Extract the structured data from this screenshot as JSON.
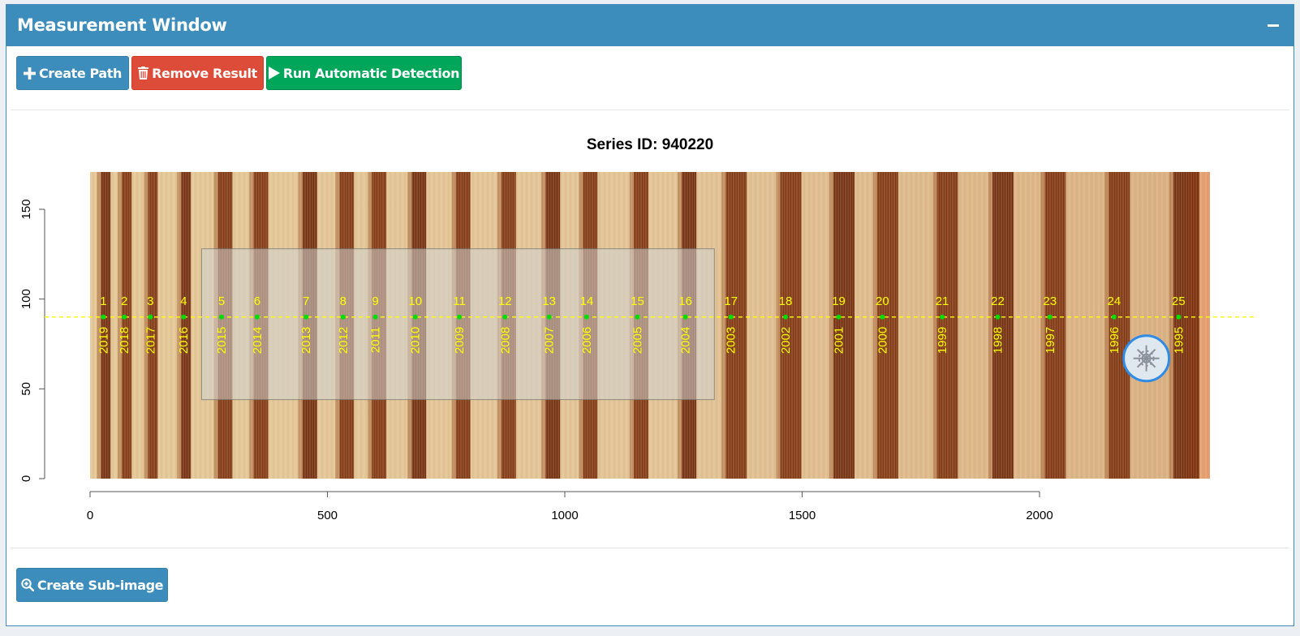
{
  "window": {
    "title": "Measurement Window",
    "collapse_icon": "minus-icon"
  },
  "toolbar": {
    "create_path_label": "Create Path",
    "remove_result_label": "Remove Result",
    "run_detection_label": "Run Automatic Detection"
  },
  "footer": {
    "create_subimage_label": "Create Sub-image"
  },
  "colors": {
    "header": "#3c8dbc",
    "btn_blue": "#3c8dbc",
    "btn_red": "#dd4b39",
    "btn_green": "#00a65a",
    "path_line": "#ffff00",
    "point": "#00dd00",
    "selection": "#cccccc"
  },
  "plot": {
    "title": "Series ID: 940220",
    "x_ticks": [
      0,
      500,
      1000,
      1500,
      2000
    ],
    "y_ticks": [
      0,
      50,
      100,
      150
    ],
    "xlim": [
      0,
      2360
    ],
    "ylim": [
      0,
      170
    ],
    "path_y": 90,
    "selection": {
      "x0": 235,
      "x1": 1315,
      "y0": 44,
      "y1": 128
    },
    "points": [
      {
        "n": "1",
        "year": "2019",
        "x": 28
      },
      {
        "n": "2",
        "year": "2018",
        "x": 72
      },
      {
        "n": "3",
        "year": "2017",
        "x": 127
      },
      {
        "n": "4",
        "year": "2016",
        "x": 197
      },
      {
        "n": "5",
        "year": "2015",
        "x": 277
      },
      {
        "n": "6",
        "year": "2014",
        "x": 352
      },
      {
        "n": "7",
        "year": "2013",
        "x": 455
      },
      {
        "n": "8",
        "year": "2012",
        "x": 533
      },
      {
        "n": "9",
        "year": "2011",
        "x": 601
      },
      {
        "n": "10",
        "year": "2010",
        "x": 685
      },
      {
        "n": "11",
        "year": "2009",
        "x": 778
      },
      {
        "n": "12",
        "year": "2008",
        "x": 874
      },
      {
        "n": "13",
        "year": "2007",
        "x": 967
      },
      {
        "n": "14",
        "year": "2006",
        "x": 1046
      },
      {
        "n": "15",
        "year": "2005",
        "x": 1153
      },
      {
        "n": "16",
        "year": "2004",
        "x": 1254
      },
      {
        "n": "17",
        "year": "2003",
        "x": 1350
      },
      {
        "n": "18",
        "year": "2002",
        "x": 1465
      },
      {
        "n": "19",
        "year": "2001",
        "x": 1577
      },
      {
        "n": "20",
        "year": "2000",
        "x": 1669
      },
      {
        "n": "21",
        "year": "1999",
        "x": 1795
      },
      {
        "n": "22",
        "year": "1998",
        "x": 1912
      },
      {
        "n": "23",
        "year": "1997",
        "x": 2022
      },
      {
        "n": "24",
        "year": "1996",
        "x": 2157
      },
      {
        "n": "25",
        "year": "1995",
        "x": 2293
      }
    ],
    "badge_icon": "snowflake-icon"
  }
}
